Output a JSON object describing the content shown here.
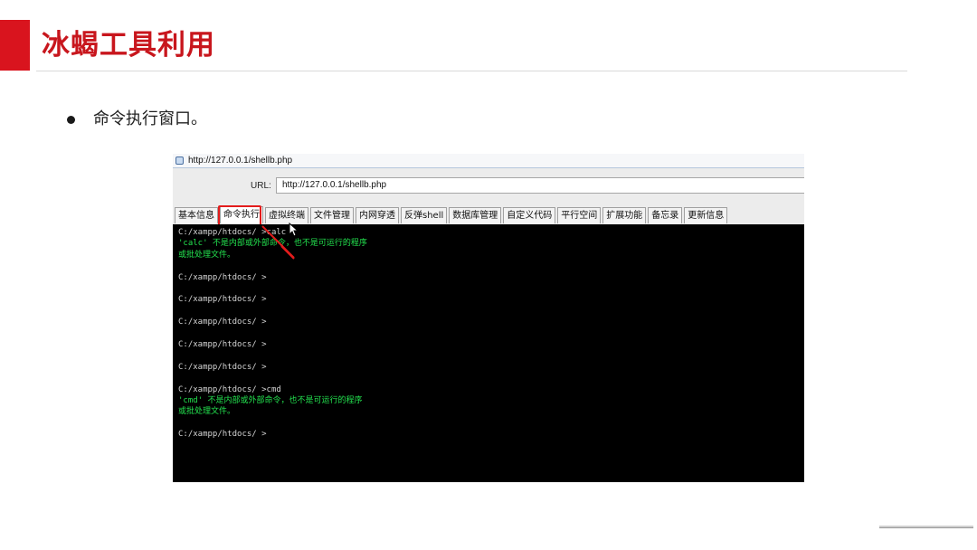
{
  "slide": {
    "title": "冰蝎工具利用",
    "bullet": "命令执行窗口。"
  },
  "window": {
    "title": "http://127.0.0.1/shellb.php",
    "url_label": "URL:",
    "url_value": "http://127.0.0.1/shellb.php"
  },
  "tabs": [
    {
      "label": "基本信息"
    },
    {
      "label": "命令执行",
      "active": true
    },
    {
      "label": "虚拟终端"
    },
    {
      "label": "文件管理"
    },
    {
      "label": "内网穿透"
    },
    {
      "label": "反弹shell"
    },
    {
      "label": "数据库管理"
    },
    {
      "label": "自定义代码"
    },
    {
      "label": "平行空间"
    },
    {
      "label": "扩展功能"
    },
    {
      "label": "备忘录"
    },
    {
      "label": "更新信息"
    }
  ],
  "terminal": {
    "lines": [
      {
        "text": "C:/xampp/htdocs/ >calc"
      },
      {
        "text": "'calc' 不是内部或外部命令，也不是可运行的程序",
        "out": true
      },
      {
        "text": "或批处理文件。",
        "out": true
      },
      {
        "text": "C:/xampp/htdocs/ >"
      },
      {
        "text": "C:/xampp/htdocs/ >"
      },
      {
        "text": "C:/xampp/htdocs/ >"
      },
      {
        "text": "C:/xampp/htdocs/ >"
      },
      {
        "text": "C:/xampp/htdocs/ >"
      },
      {
        "text": "C:/xampp/htdocs/ >cmd"
      },
      {
        "text": "'cmd' 不是内部或外部命令，也不是可运行的程序",
        "out": true
      },
      {
        "text": "或批处理文件。",
        "out": true
      },
      {
        "text": "C:/xampp/htdocs/ >"
      }
    ]
  },
  "colors": {
    "accent": "#d9141e",
    "title": "#c8161d",
    "terminal_bg": "#000000",
    "terminal_output": "#23e34f",
    "highlight": "#e31c1c"
  }
}
